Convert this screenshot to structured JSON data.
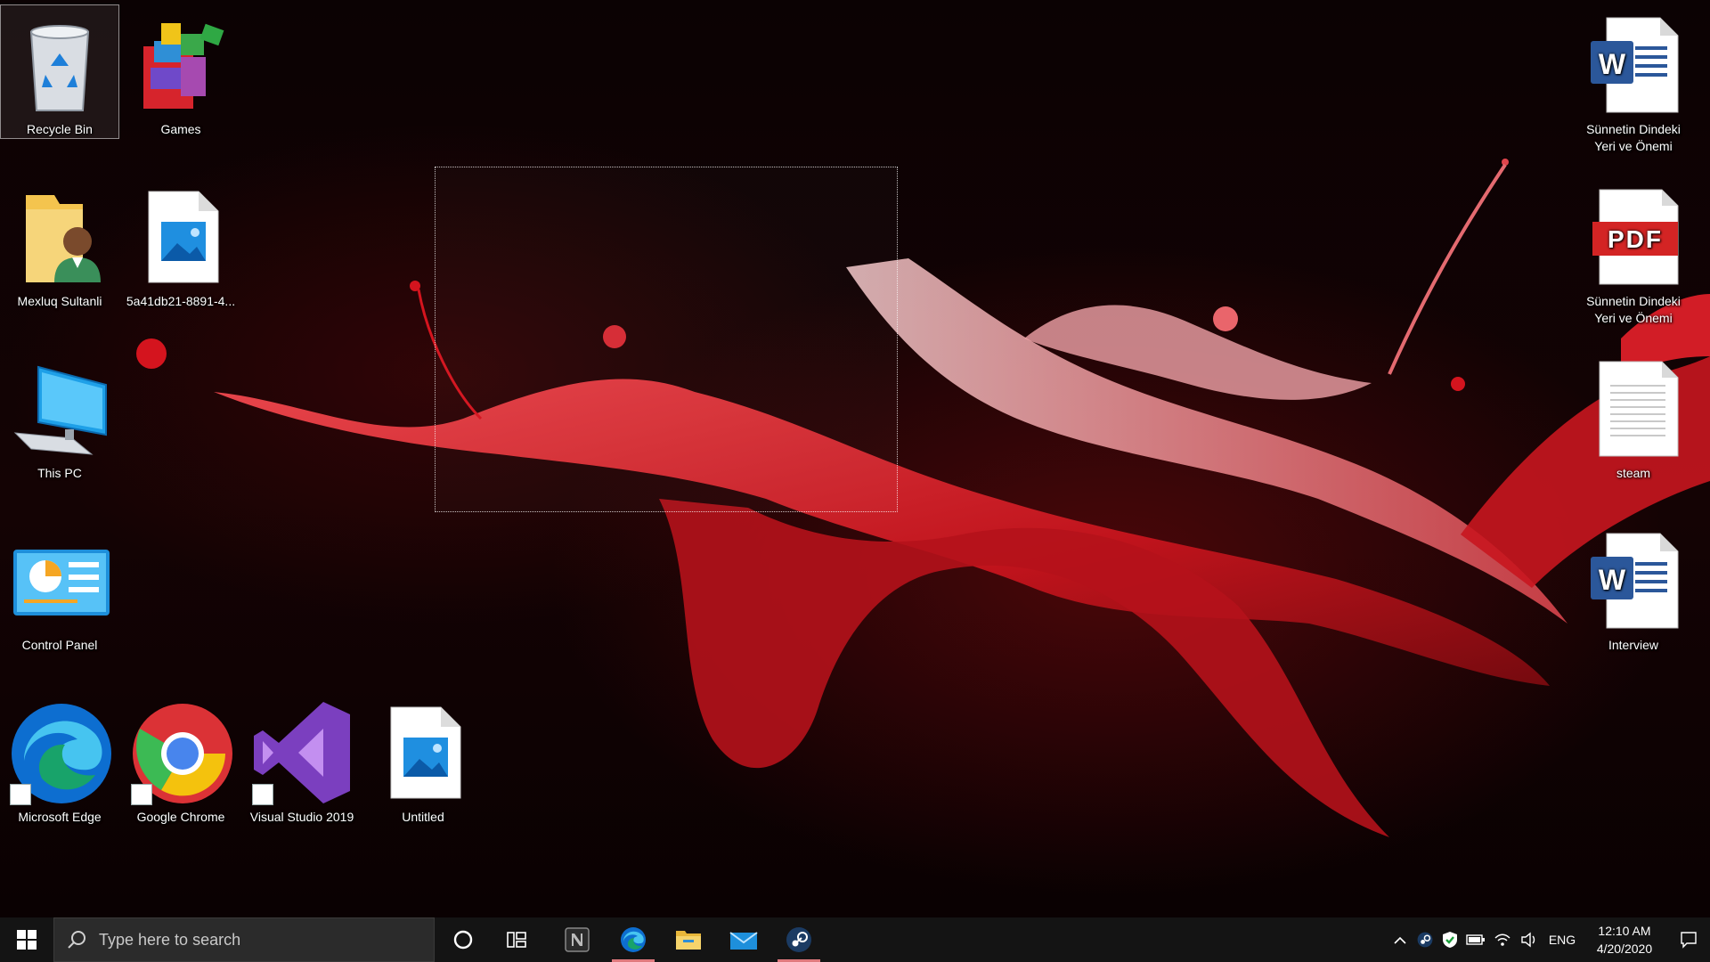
{
  "desktop": {
    "icons": [
      {
        "label": "Recycle Bin",
        "icon": "recycle-bin-icon",
        "selected": true
      },
      {
        "label": "Games",
        "icon": "games-folder-icon"
      },
      {
        "label": "Mexluq Sultanli",
        "icon": "user-folder-icon"
      },
      {
        "label": "5a41db21-8891-4...",
        "icon": "image-file-icon"
      },
      {
        "label": "This PC",
        "icon": "this-pc-icon"
      },
      {
        "label": "Control Panel",
        "icon": "control-panel-icon"
      },
      {
        "label": "Microsoft Edge",
        "icon": "edge-icon"
      },
      {
        "label": "Google Chrome",
        "icon": "chrome-icon"
      },
      {
        "label": "Visual Studio 2019",
        "icon": "visual-studio-icon"
      },
      {
        "label": "Untitled",
        "icon": "image-file-icon"
      },
      {
        "label": "Sünnetin Dindeki Yeri ve Önemi",
        "icon": "word-document-icon"
      },
      {
        "label": "Sünnetin Dindeki Yeri ve Önemi",
        "icon": "pdf-document-icon"
      },
      {
        "label": "steam",
        "icon": "text-document-icon"
      },
      {
        "label": "Interview",
        "icon": "word-document-icon"
      }
    ],
    "pdf_badge": "PDF",
    "word_badge": "W"
  },
  "taskbar": {
    "search_placeholder": "Type here to search",
    "pinned": [
      "cortana-icon",
      "task-view-icon",
      "notion-icon",
      "edge-icon",
      "file-explorer-icon",
      "mail-icon",
      "steam-icon"
    ],
    "tray": {
      "language": "ENG",
      "time": "12:10 AM",
      "date": "4/20/2020"
    }
  },
  "colors": {
    "accent_red": "#d8222c",
    "taskbar_bg": "#141414",
    "active_indicator": "#e07a7e"
  }
}
